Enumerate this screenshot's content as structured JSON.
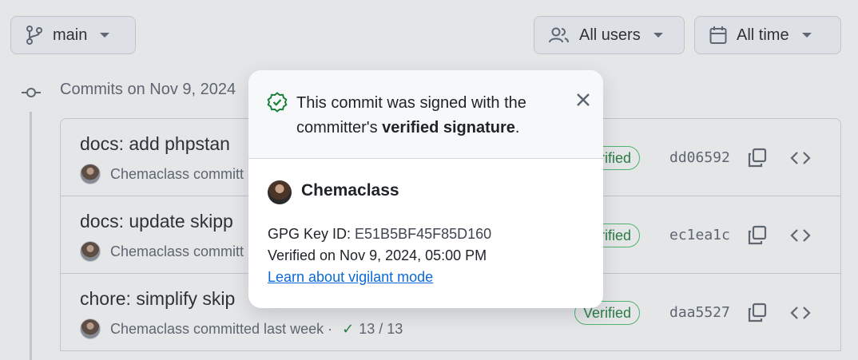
{
  "toolbar": {
    "branch_label": "main",
    "users_label": "All users",
    "time_label": "All time"
  },
  "group": {
    "heading": "Commits on Nov 9, 2024"
  },
  "commits": [
    {
      "title": "docs: add phpstan",
      "meta": "Chemaclass committ",
      "verified": "Verified",
      "sha": "dd06592"
    },
    {
      "title": "docs: update skipp",
      "meta": "Chemaclass committ",
      "verified": "Verified",
      "sha": "ec1ea1c"
    },
    {
      "title": "chore: simplify skip",
      "meta": "Chemaclass committed last week ·",
      "checks": "13 / 13",
      "verified": "Verified",
      "sha": "daa5527"
    }
  ],
  "popover": {
    "message_start": "This commit was signed with the committer's ",
    "message_bold": "verified signature",
    "message_end": ".",
    "username": "Chemaclass",
    "gpg_label": "GPG Key ID: ",
    "gpg_value": "E51B5BF45F85D160",
    "verified_on": "Verified on Nov 9, 2024, 05:00 PM",
    "learn_link": "Learn about vigilant mode"
  },
  "colors": {
    "success": "#1a7f37",
    "link": "#0969da",
    "border": "#d0d7de"
  },
  "icons": {
    "branch": "git-branch-icon",
    "users": "people-icon",
    "calendar": "calendar-icon",
    "commit": "git-commit-icon",
    "copy": "copy-icon",
    "code": "code-icon",
    "shield": "verified-shield-icon",
    "close": "close-icon"
  }
}
